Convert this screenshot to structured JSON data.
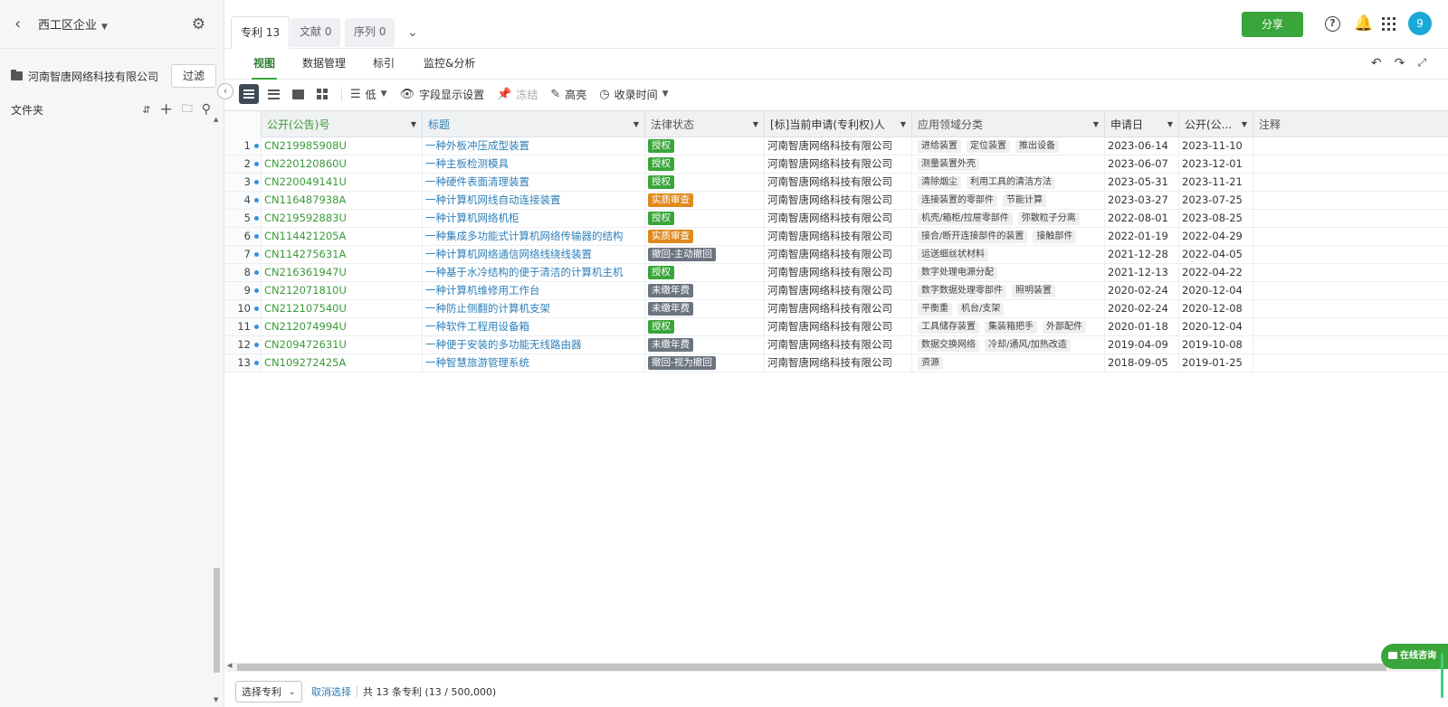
{
  "sidebar": {
    "workspace": "西工区企业",
    "company": "河南智唐网络科技有限公司",
    "filter_label": "过滤",
    "folder_label": "文件夹"
  },
  "tabs": [
    {
      "label": "专利 13"
    },
    {
      "label": "文献 0"
    },
    {
      "label": "序列 0"
    }
  ],
  "header": {
    "share_label": "分享",
    "avatar_text": "9"
  },
  "subnav": [
    {
      "label": "视图"
    },
    {
      "label": "数据管理"
    },
    {
      "label": "标引"
    },
    {
      "label": "监控&分析"
    }
  ],
  "toolbar": {
    "density_label": "低",
    "field_settings_label": "字段显示设置",
    "freeze_label": "冻结",
    "highlight_label": "高亮",
    "sort_label": "收录时间"
  },
  "columns": {
    "pub": "公开(公告)号",
    "title": "标题",
    "legal": "法律状态",
    "applicant": "[标]当前申请(专利权)人",
    "field": "应用领域分类",
    "date1": "申请日",
    "date2": "公开(公...",
    "note": "注释"
  },
  "rows": [
    {
      "idx": "1",
      "pub": "CN219985908U",
      "title": "一种外板冲压成型装置",
      "legal": "授权",
      "legal_color": "#3aa53a",
      "applicant": "河南智唐网络科技有限公司",
      "fields": [
        "进给装置",
        "定位装置",
        "推出设备"
      ],
      "date1": "2023-06-14",
      "date2": "2023-11-10"
    },
    {
      "idx": "2",
      "pub": "CN220120860U",
      "title": "一种主板检测模具",
      "legal": "授权",
      "legal_color": "#3aa53a",
      "applicant": "河南智唐网络科技有限公司",
      "fields": [
        "测量装置外壳"
      ],
      "date1": "2023-06-07",
      "date2": "2023-12-01"
    },
    {
      "idx": "3",
      "pub": "CN220049141U",
      "title": "一种硬件表面清理装置",
      "legal": "授权",
      "legal_color": "#3aa53a",
      "applicant": "河南智唐网络科技有限公司",
      "fields": [
        "清除烟尘",
        "利用工具的清洁方法"
      ],
      "date1": "2023-05-31",
      "date2": "2023-11-21"
    },
    {
      "idx": "4",
      "pub": "CN116487938A",
      "title": "一种计算机网线自动连接装置",
      "legal": "实质审查",
      "legal_color": "#e08a1e",
      "applicant": "河南智唐网络科技有限公司",
      "fields": [
        "连接装置的零部件",
        "节能计算"
      ],
      "date1": "2023-03-27",
      "date2": "2023-07-25"
    },
    {
      "idx": "5",
      "pub": "CN219592883U",
      "title": "一种计算机网络机柜",
      "legal": "授权",
      "legal_color": "#3aa53a",
      "applicant": "河南智唐网络科技有限公司",
      "fields": [
        "机壳/箱柜/拉屉零部件",
        "弥散粒子分离"
      ],
      "date1": "2022-08-01",
      "date2": "2023-08-25"
    },
    {
      "idx": "6",
      "pub": "CN114421205A",
      "title": "一种集成多功能式计算机网络传输器的结构",
      "legal": "实质审查",
      "legal_color": "#e08a1e",
      "applicant": "河南智唐网络科技有限公司",
      "fields": [
        "接合/断开连接部件的装置",
        "接触部件"
      ],
      "date1": "2022-01-19",
      "date2": "2022-04-29"
    },
    {
      "idx": "7",
      "pub": "CN114275631A",
      "title": "一种计算机网络通信网络线绕线装置",
      "legal": "撤回-主动撤回",
      "legal_color": "#6b7480",
      "applicant": "河南智唐网络科技有限公司",
      "fields": [
        "运送细丝状材料"
      ],
      "date1": "2021-12-28",
      "date2": "2022-04-05"
    },
    {
      "idx": "8",
      "pub": "CN216361947U",
      "title": "一种基于水冷结构的便于清洁的计算机主机",
      "legal": "授权",
      "legal_color": "#3aa53a",
      "applicant": "河南智唐网络科技有限公司",
      "fields": [
        "数字处理电源分配"
      ],
      "date1": "2021-12-13",
      "date2": "2022-04-22"
    },
    {
      "idx": "9",
      "pub": "CN212071810U",
      "title": "一种计算机维修用工作台",
      "legal": "未缴年费",
      "legal_color": "#6b7480",
      "applicant": "河南智唐网络科技有限公司",
      "fields": [
        "数字数据处理零部件",
        "照明装置"
      ],
      "date1": "2020-02-24",
      "date2": "2020-12-04"
    },
    {
      "idx": "10",
      "pub": "CN212107540U",
      "title": "一种防止侧翻的计算机支架",
      "legal": "未缴年费",
      "legal_color": "#6b7480",
      "applicant": "河南智唐网络科技有限公司",
      "fields": [
        "平衡重",
        "机台/支架"
      ],
      "date1": "2020-02-24",
      "date2": "2020-12-08"
    },
    {
      "idx": "11",
      "pub": "CN212074994U",
      "title": "一种软件工程用设备箱",
      "legal": "授权",
      "legal_color": "#3aa53a",
      "applicant": "河南智唐网络科技有限公司",
      "fields": [
        "工具储存装置",
        "集装箱把手",
        "外部配件"
      ],
      "date1": "2020-01-18",
      "date2": "2020-12-04"
    },
    {
      "idx": "12",
      "pub": "CN209472631U",
      "title": "一种便于安装的多功能无线路由器",
      "legal": "未缴年费",
      "legal_color": "#6b7480",
      "applicant": "河南智唐网络科技有限公司",
      "fields": [
        "数据交换网络",
        "冷却/通风/加热改造"
      ],
      "date1": "2019-04-09",
      "date2": "2019-10-08"
    },
    {
      "idx": "13",
      "pub": "CN109272425A",
      "title": "一种智慧旅游管理系统",
      "legal": "撤回-视为撤回",
      "legal_color": "#6b7480",
      "applicant": "河南智唐网络科技有限公司",
      "fields": [
        "资源"
      ],
      "date1": "2018-09-05",
      "date2": "2019-01-25"
    }
  ],
  "footer": {
    "select_label": "选择专利",
    "cancel_label": "取消选择",
    "count_text": "共 13 条专利 (13 / 500,000)"
  },
  "chat": {
    "label": "在线咨询"
  }
}
